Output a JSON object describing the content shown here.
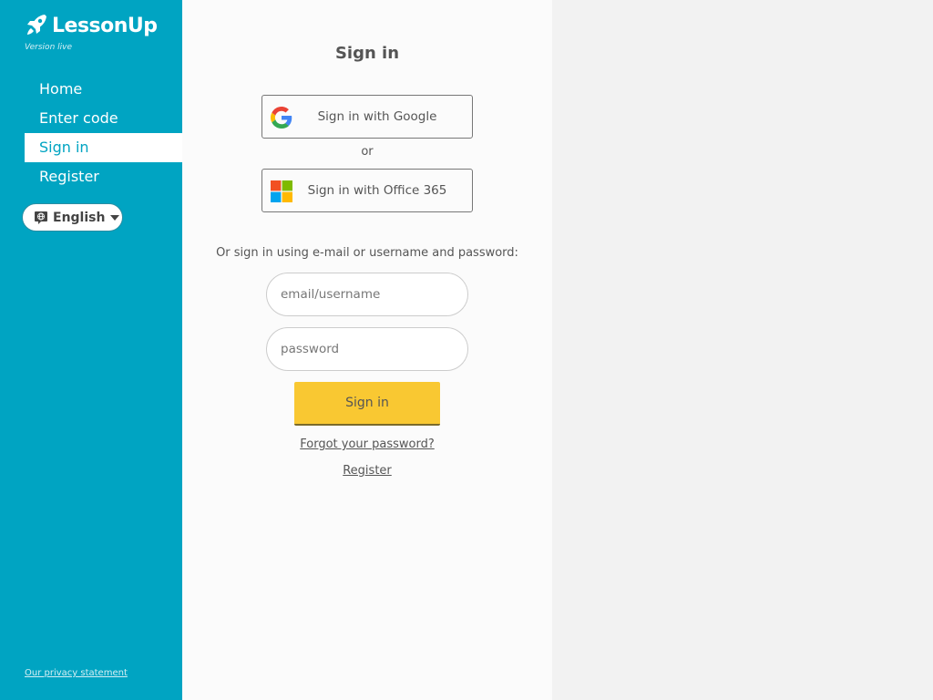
{
  "brand": {
    "name": "LessonUp",
    "version": "Version live",
    "logo_icon": "rocket-icon"
  },
  "sidebar": {
    "items": [
      {
        "label": "Home",
        "active": false
      },
      {
        "label": "Enter code",
        "active": false
      },
      {
        "label": "Sign in",
        "active": true
      },
      {
        "label": "Register",
        "active": false
      }
    ],
    "language": {
      "label": "English",
      "icon": "globe-icon"
    },
    "privacy": "Our privacy statement"
  },
  "signin": {
    "title": "Sign in",
    "google_label": "Sign in with Google",
    "or": "or",
    "office_label": "Sign in with Office 365",
    "alternative_text": "Or sign in using e-mail or username and password:",
    "email_placeholder": "email/username",
    "password_placeholder": "password",
    "submit_label": "Sign in",
    "forgot_label": "Forgot your password?",
    "register_label": "Register"
  },
  "colors": {
    "sidebar_bg": "#00a4c2",
    "submit_bg": "#f9c832",
    "main_bg": "#fbfbfb",
    "page_bg": "#f2f2f2"
  }
}
